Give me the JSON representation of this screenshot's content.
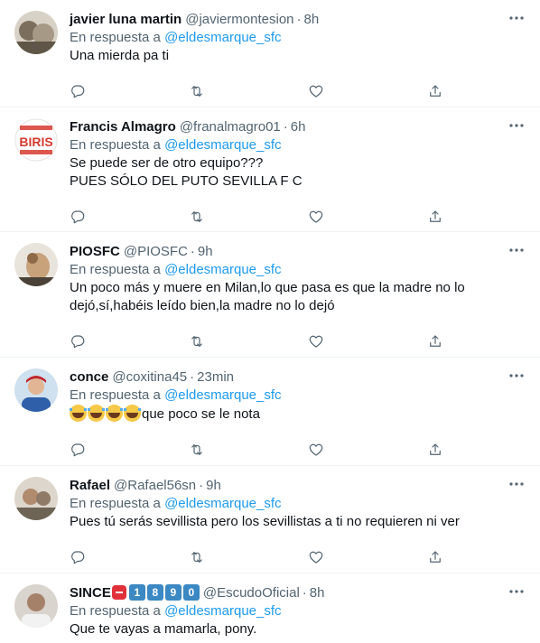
{
  "labels": {
    "replying_to": "En respuesta a"
  },
  "tweets": [
    {
      "name": "javier luna martin",
      "handle": "@javiermontesion",
      "time": "8h",
      "mention": "@eldesmarque_sfc",
      "text": [
        "Una mierda pa ti"
      ],
      "avatar_color": "#8a7f70"
    },
    {
      "name": "Francis Almagro",
      "handle": "@franalmagro01",
      "time": "6h",
      "mention": "@eldesmarque_sfc",
      "text": [
        "Se puede ser de otro equipo???",
        "PUES SÓLO DEL PUTO SEVILLA F C"
      ],
      "avatar_color": "#d63a2f",
      "avatar_text": "BIRIS"
    },
    {
      "name": "PIOSFC",
      "handle": "@PIOSFC",
      "time": "9h",
      "mention": "@eldesmarque_sfc",
      "text": [
        "Un poco más y muere en Milan,lo que pasa es que la madre no lo",
        "dejó,sí,habéis leído bien,la madre no lo dejó"
      ],
      "avatar_color": "#6d6351"
    },
    {
      "name": "conce",
      "handle": "@coxitina45",
      "time": "23min",
      "mention": "@eldesmarque_sfc",
      "text": [
        "que poco se le nota"
      ],
      "emoji_count": 4,
      "avatar_color": "#7fa8c9"
    },
    {
      "name": "Rafael",
      "handle": "@Rafael56sn",
      "time": "9h",
      "mention": "@eldesmarque_sfc",
      "text": [
        "Pues tú serás sevillista pero los sevillistas a ti no requieren ni ver"
      ],
      "avatar_color": "#a39a8d"
    },
    {
      "name": "SINCE",
      "name_badges": [
        "1",
        "8",
        "9",
        "0"
      ],
      "handle": "@EscudoOficial",
      "time": "8h",
      "mention": "@eldesmarque_sfc",
      "text": [
        "Que te vayas a mamarla, pony."
      ],
      "avatar_color": "#9c8f83"
    }
  ],
  "icons": {
    "more": "more-icon",
    "reply": "reply-icon",
    "retweet": "retweet-icon",
    "like": "like-icon",
    "share": "share-icon"
  }
}
